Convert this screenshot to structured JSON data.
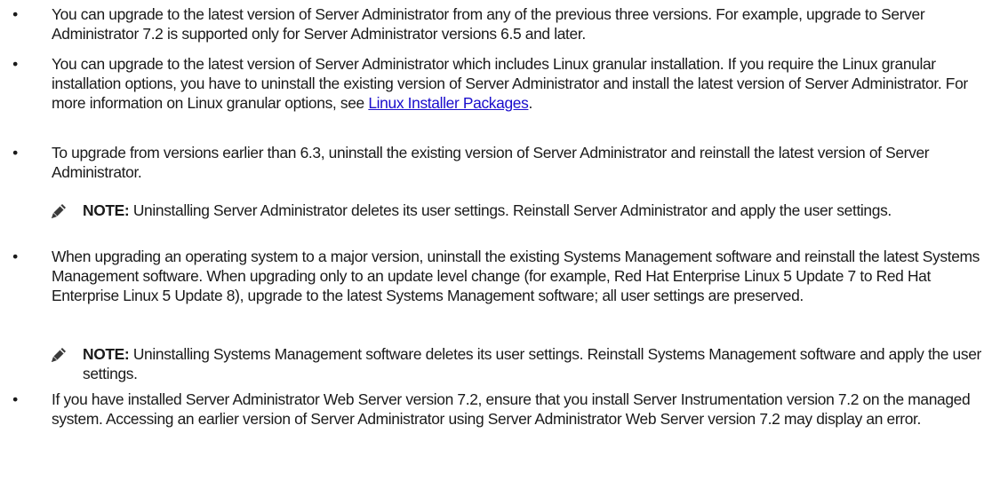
{
  "bullets": [
    {
      "text": "You can upgrade to the latest version of Server Administrator from any of the previous three versions. For example, upgrade to Server Administrator 7.2 is supported only for Server Administrator versions 6.5 and later."
    },
    {
      "text_before_link": "You can upgrade to the latest version of Server Administrator which includes Linux granular installation. If you require the Linux granular installation options, you have to uninstall the existing version of Server Administrator and install the latest version of Server Administrator. For more information on Linux granular options, see ",
      "link_text": "Linux Installer Packages",
      "text_after_link": "."
    },
    {
      "text": "To upgrade from versions earlier than 6.3, uninstall the existing version of Server Administrator and reinstall the latest version of Server Administrator."
    },
    {
      "text": "When upgrading an operating system to a major version, uninstall the existing Systems Management software and reinstall the latest Systems Management software. When upgrading only to an update level change (for example, Red Hat Enterprise Linux 5 Update 7 to Red Hat Enterprise Linux 5 Update 8), upgrade to the latest Systems Management software; all user settings are preserved."
    },
    {
      "text": "If you have installed Server Administrator Web Server version 7.2, ensure that you install Server Instrumentation version 7.2 on the managed system. Accessing an earlier version of Server Administrator using Server Administrator Web Server version 7.2 may display an error."
    }
  ],
  "bullet_symbol": "•",
  "notes": [
    {
      "label": "NOTE:",
      "text": " Uninstalling Server Administrator deletes its user settings. Reinstall Server Administrator and apply the user settings."
    },
    {
      "label": "NOTE:",
      "text": " Uninstalling Systems Management software deletes its user settings. Reinstall Systems Management software and apply the user settings."
    }
  ],
  "icons": {
    "note": "pencil-note-icon"
  },
  "colors": {
    "text": "#1a1a1a",
    "link": "#1a0dcc"
  }
}
